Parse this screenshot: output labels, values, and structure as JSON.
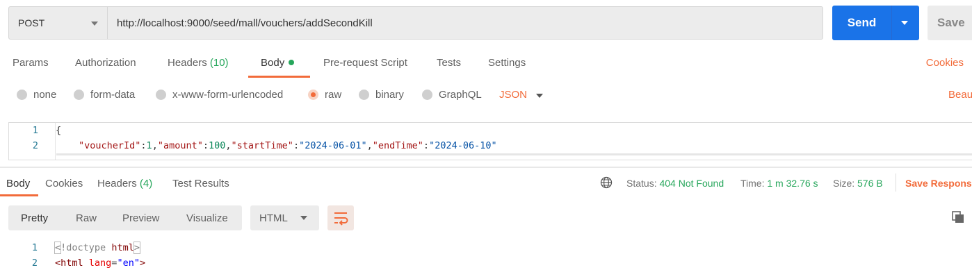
{
  "request": {
    "method": "POST",
    "url": "http://localhost:9000/seed/mall/vouchers/addSecondKill",
    "send_label": "Send",
    "save_label": "Save"
  },
  "request_tabs": [
    {
      "label": "Params"
    },
    {
      "label": "Authorization"
    },
    {
      "label": "Headers",
      "count": "(10)"
    },
    {
      "label": "Body"
    },
    {
      "label": "Pre-request Script"
    },
    {
      "label": "Tests"
    },
    {
      "label": "Settings"
    }
  ],
  "cookies_label": "Cookies",
  "body_types": [
    {
      "label": "none"
    },
    {
      "label": "form-data"
    },
    {
      "label": "x-www-form-urlencoded"
    },
    {
      "label": "raw"
    },
    {
      "label": "binary"
    },
    {
      "label": "GraphQL"
    }
  ],
  "raw_format": "JSON",
  "beautify_label": "Beau",
  "editor": {
    "line_numbers": [
      "1",
      "2"
    ],
    "line1": "{",
    "body": {
      "k1": "\"voucherId\"",
      "v1": "1",
      "k2": "\"amount\"",
      "v2": "100",
      "k3": "\"startTime\"",
      "v3": "\"2024-06-01\"",
      "k4": "\"endTime\"",
      "v4": "\"2024-06-10\""
    }
  },
  "response_tabs": [
    {
      "label": "Body"
    },
    {
      "label": "Cookies"
    },
    {
      "label": "Headers",
      "count": "(4)"
    },
    {
      "label": "Test Results"
    }
  ],
  "status": {
    "status_label": "Status:",
    "status_value": "404 Not Found",
    "time_label": "Time:",
    "time_value": "1 m 32.76 s",
    "size_label": "Size:",
    "size_value": "576 B",
    "save_response_label": "Save Respons"
  },
  "view_modes": [
    {
      "label": "Pretty"
    },
    {
      "label": "Raw"
    },
    {
      "label": "Preview"
    },
    {
      "label": "Visualize"
    }
  ],
  "response_format": "HTML",
  "response_code": {
    "line_numbers": [
      "1",
      "2"
    ],
    "l1_open": "<",
    "l1_doctype": "!doctype",
    "l1_html": "html",
    "l1_close": ">",
    "l2_open": "<html",
    "l2_attr": "lang",
    "l2_eq": "=",
    "l2_val": "\"en\"",
    "l2_close": ">"
  },
  "colors": {
    "accent": "#f26b3a",
    "send": "#1a73e8",
    "success": "#26a65b"
  }
}
